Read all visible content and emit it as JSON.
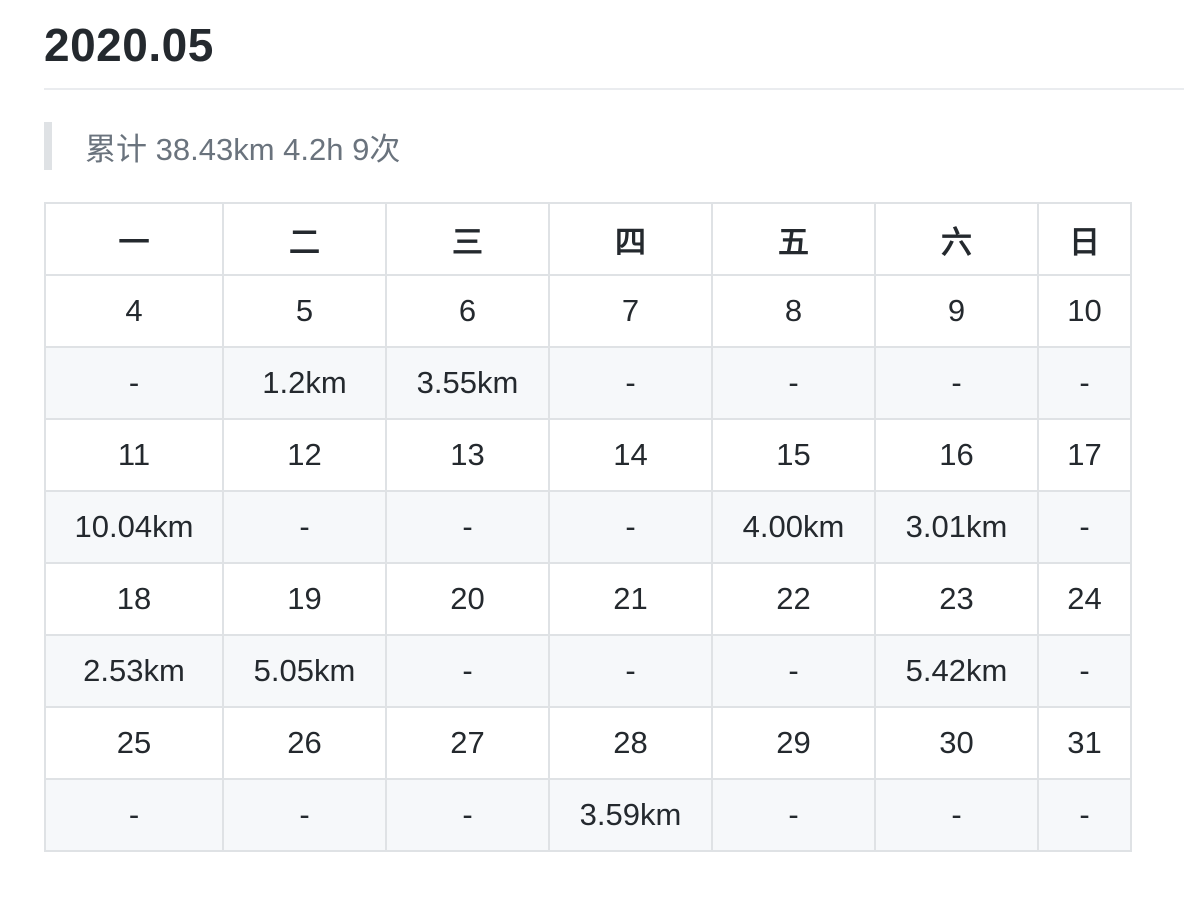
{
  "page": {
    "title": "2020.05",
    "summary": "累计 38.43km 4.2h 9次"
  },
  "calendar": {
    "headers": [
      "一",
      "二",
      "三",
      "四",
      "五",
      "六",
      "日"
    ],
    "weeks": [
      {
        "dates": [
          "4",
          "5",
          "6",
          "7",
          "8",
          "9",
          "10"
        ],
        "distances": [
          "-",
          "1.2km",
          "3.55km",
          "-",
          "-",
          "-",
          "-"
        ]
      },
      {
        "dates": [
          "11",
          "12",
          "13",
          "14",
          "15",
          "16",
          "17"
        ],
        "distances": [
          "10.04km",
          "-",
          "-",
          "-",
          "4.00km",
          "3.01km",
          "-"
        ]
      },
      {
        "dates": [
          "18",
          "19",
          "20",
          "21",
          "22",
          "23",
          "24"
        ],
        "distances": [
          "2.53km",
          "5.05km",
          "-",
          "-",
          "-",
          "5.42km",
          "-"
        ]
      },
      {
        "dates": [
          "25",
          "26",
          "27",
          "28",
          "29",
          "30",
          "31"
        ],
        "distances": [
          "-",
          "-",
          "-",
          "3.59km",
          "-",
          "-",
          "-"
        ]
      }
    ]
  },
  "colors": {
    "text": "#24292e",
    "muted_text": "#6a737d",
    "border": "#dfe2e5",
    "alt_row": "#f6f8fa"
  }
}
